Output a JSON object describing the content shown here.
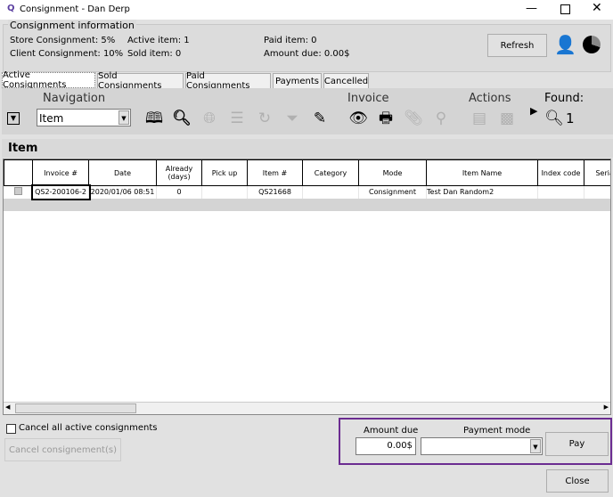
{
  "window": {
    "title": "Consignment - Dan Derp"
  },
  "info": {
    "legend": "Consignment information",
    "store": "Store Consignment: 5%",
    "client": "Client Consignment: 10%",
    "active": "Active item: 1",
    "sold": "Sold item: 0",
    "paid": "Paid item: 0",
    "amount_due": "Amount due: 0.00$",
    "refresh": "Refresh"
  },
  "tabs": [
    "Active Consignments",
    "Sold Consignments",
    "Paid Consignments",
    "Payments",
    "Cancelled"
  ],
  "toolbar": {
    "navigation": "Navigation",
    "nav_select": "Item",
    "invoice": "Invoice",
    "actions": "Actions",
    "found_label": "Found:",
    "found_count": "1"
  },
  "section": "Item",
  "table": {
    "headers": [
      "",
      "Invoice #",
      "Date",
      "Already (days)",
      "Pick up",
      "Item #",
      "Category",
      "Mode",
      "Item Name",
      "Index code",
      "Serial num"
    ],
    "rows": [
      [
        "",
        "QS2-200106-2",
        "2020/01/06 08:51",
        "0",
        "",
        "QS21668",
        "",
        "Consignment",
        "Test Dan Random2",
        "",
        ""
      ]
    ]
  },
  "bottom": {
    "cancel_all": "Cancel all active consignments",
    "cancel_btn": "Cancel consignement(s)",
    "amount_due_label": "Amount due",
    "amount_due_value": "0.00$",
    "payment_mode_label": "Payment mode",
    "payment_mode_value": "",
    "pay": "Pay",
    "close": "Close"
  },
  "colors": {
    "highlight": "#6b2c91"
  }
}
